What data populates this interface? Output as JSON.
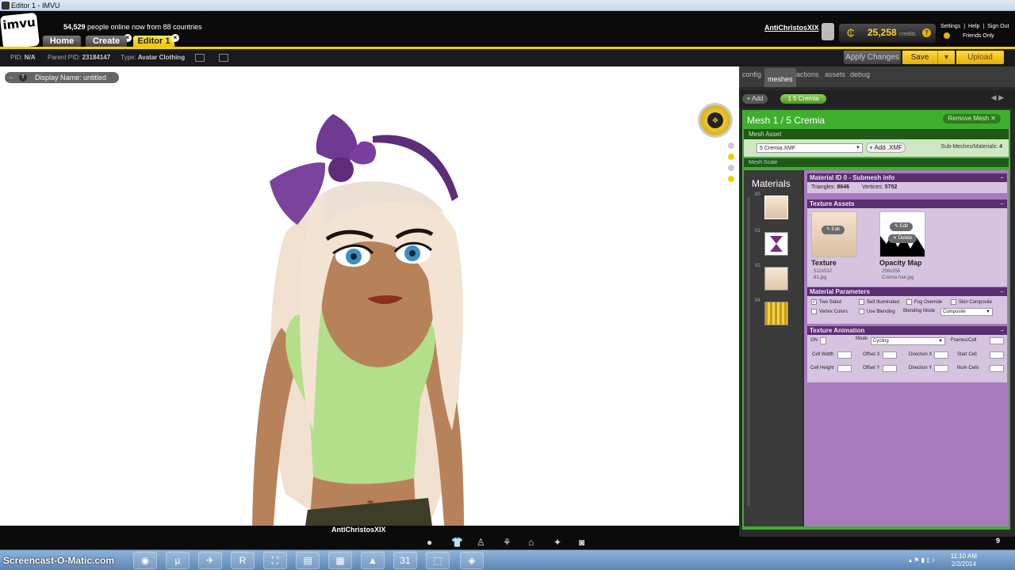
{
  "window": {
    "title": "Editor 1 - IMVU"
  },
  "header": {
    "logo": "imvu",
    "online_count": "54,529",
    "online_text": "people online now from 88 countries",
    "tabs": [
      "Home",
      "Create",
      "Editor 1"
    ],
    "username": "AntiChristosXIX",
    "credits": "25,258",
    "credits_label": "credits",
    "links": [
      "Settings",
      "|",
      "Help",
      "|",
      "Sign Out"
    ],
    "friends_only": "Friends Only"
  },
  "infobar": {
    "pid_label": "PID:",
    "pid": "N/A",
    "parent_label": "Parent PID:",
    "parent_pid": "23184147",
    "type_label": "Type:",
    "type": "Avatar Clothing",
    "apply_changes": "Apply Changes",
    "save": "Save",
    "upload": "Upload"
  },
  "viewport": {
    "display_name": "Display Name: untitled",
    "avatar_name": "AntiChristosXIX"
  },
  "panel": {
    "tabs": [
      "config",
      "meshes",
      "actions",
      "assets",
      "debug"
    ],
    "active_tab": "meshes",
    "add_label": "Add",
    "mesh_chip": "1 5 Cremia",
    "mesh_title": "Mesh 1 / 5 Cremia",
    "remove_mesh": "Remove Mesh",
    "mesh_asset_header": "Mesh Asset",
    "xmf_file": "5 Cremia.XMF",
    "add_xmf": "Add .XMF",
    "submesh_label": "Sub-Meshes/Materials:",
    "submesh_count": "4",
    "mesh_scale_header": "Mesh Scale",
    "materials_heading": "Materials",
    "material_indices": [
      "00",
      "01",
      "02",
      "04"
    ],
    "material_header": "Material ID 0 - Submesh info",
    "triangles_label": "Triangles:",
    "triangles": "8646",
    "vertices_label": "Vertices:",
    "vertices": "5752",
    "texture_assets_header": "Texture Assets",
    "texture": {
      "name": "Texture",
      "size": "512x512",
      "file": "81.jpg",
      "edit": "Edit"
    },
    "opacity": {
      "name": "Opacity Map",
      "size": "256x256",
      "file": "Cremia hair.jpg",
      "edit": "Edit",
      "delete": "Delete"
    },
    "params_header": "Material Parameters",
    "params": {
      "two_sided": "Two Sided",
      "self_illuminated": "Self Illuminated",
      "fog_override": "Fog Override",
      "skin_composite": "Skin Composite",
      "vertex_colors": "Vertex Colors",
      "use_blending": "Use Blending",
      "blending_mode_label": "Blending Mode",
      "blending_mode": "Composite"
    },
    "anim_header": "Texture Animation",
    "anim": {
      "on": "ON",
      "mode_label": "Mode",
      "mode": "Cycling",
      "frames_cell": "Frames/Cell",
      "cell_width": "Cell Width",
      "offset_x": "Offset X",
      "direction_x": "Direction X",
      "start_cell": "Start Cell",
      "cell_height": "Cell Height",
      "offset_y": "Offset Y",
      "direction_y": "Direction Y",
      "num_cells": "Num Cells"
    },
    "page_num": "9"
  },
  "taskbar": {
    "watermark": "Screencast-O-Matic.com",
    "time": "11:10 AM",
    "date": "2/2/2014",
    "calendar_day": "31"
  },
  "colors": {
    "accent_yellow": "#f5d000",
    "mesh_green": "#3faf2e",
    "material_purple": "#a77bbd"
  }
}
